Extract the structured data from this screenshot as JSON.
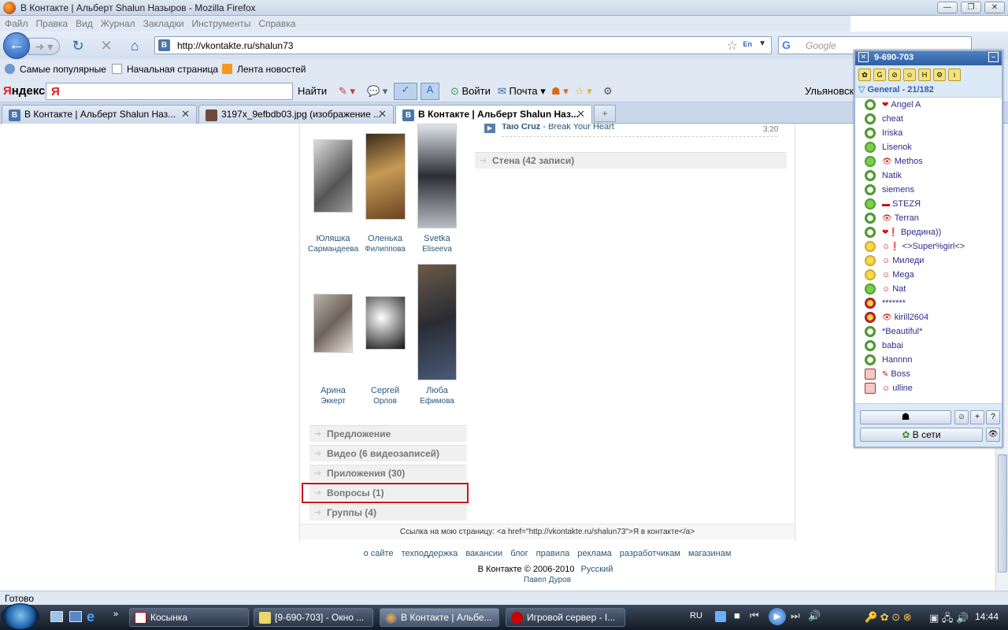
{
  "window": {
    "title": "В Контакте | Альберт Shalun Назыров - Mozilla Firefox",
    "buttons": [
      "—",
      "❐",
      "✕"
    ]
  },
  "menu": [
    "Файл",
    "Правка",
    "Вид",
    "Журнал",
    "Закладки",
    "Инструменты",
    "Справка"
  ],
  "navbar": {
    "url": "http://vkontakte.ru/shalun73",
    "lang_badge": "En",
    "search_placeholder": "Google"
  },
  "bookmarks": [
    "Самые популярные",
    "Начальная страница",
    "Лента новостей"
  ],
  "yandex": {
    "logo_prefix": "Я",
    "logo_rest": "ндекс",
    "input_logo": "Я",
    "find": "Найти",
    "login": "Войти",
    "mail": "Почта",
    "city": "Ульяновск"
  },
  "tabs": [
    {
      "label": "В Контакте | Альберт Shalun Наз..."
    },
    {
      "label": "3197x_9efbdb03.jpg (изображение ..."
    },
    {
      "label": "В Контакте | Альберт Shalun Наз..."
    }
  ],
  "page": {
    "friends": [
      {
        "first": "Юляшка",
        "last": "Сармандеева"
      },
      {
        "first": "Оленька",
        "last": "Филиппова"
      },
      {
        "first": "Svetka",
        "last": "Eliseeva"
      },
      {
        "first": "Арина",
        "last": "Эккерт"
      },
      {
        "first": "Сергей",
        "last": "Орлов"
      },
      {
        "first": "Люба",
        "last": "Ефимова"
      }
    ],
    "sections": [
      "Предложение",
      "Видео (6 видеозаписей)",
      "Приложения (30)",
      "Вопросы (1)",
      "Группы (4)"
    ],
    "music": {
      "artist": "Taio Cruz",
      "title": " - Break Your Heart",
      "duration": "3:20"
    },
    "wall": "Стена (42 записи)",
    "link_line": "Ссылка на мою страницу: <a href=\"http://vkontakte.ru/shalun73\">Я в контакте</a>",
    "footer_links": [
      "о сайте",
      "техподдержка",
      "вакансии",
      "блог",
      "правила",
      "реклама",
      "разработчикам",
      "магазинам"
    ],
    "copyright": "В Контакте © 2006-2010",
    "language": "Русский",
    "author": "Павел Дуров"
  },
  "icq": {
    "title": "9-690-703",
    "group": "General - ",
    "group_count": "21/182",
    "contacts": [
      {
        "name": "Angel A",
        "status": "off",
        "extra": "❤"
      },
      {
        "name": "cheat",
        "status": "off",
        "extra": ""
      },
      {
        "name": "Iriska",
        "status": "off",
        "extra": ""
      },
      {
        "name": "Lisenok",
        "status": "on",
        "extra": ""
      },
      {
        "name": "Methos",
        "status": "on",
        "extra": "👁"
      },
      {
        "name": "Natik",
        "status": "off",
        "extra": ""
      },
      {
        "name": "siemens",
        "status": "off",
        "extra": ""
      },
      {
        "name": "STEZЯ",
        "status": "on",
        "extra": "▬"
      },
      {
        "name": "Terran",
        "status": "off",
        "extra": "👁"
      },
      {
        "name": "Вредина))",
        "status": "off",
        "extra": "❤❗"
      },
      {
        "name": "<>Super%girl<>",
        "status": "away",
        "extra": "☺❗"
      },
      {
        "name": "Миледи",
        "status": "away",
        "extra": "☺"
      },
      {
        "name": "Mega",
        "status": "away",
        "extra": "☺"
      },
      {
        "name": "Nat",
        "status": "on",
        "extra": "☺"
      },
      {
        "name": "*******",
        "status": "dnd",
        "extra": ""
      },
      {
        "name": "kirill2604",
        "status": "dnd",
        "extra": "👁"
      },
      {
        "name": "*Beautiful*",
        "status": "off",
        "extra": ""
      },
      {
        "name": "babai",
        "status": "off",
        "extra": ""
      },
      {
        "name": "Hannnn",
        "status": "off",
        "extra": ""
      },
      {
        "name": "Boss",
        "status": "na",
        "extra": "✎"
      },
      {
        "name": "ulline",
        "status": "na",
        "extra": "☺"
      }
    ],
    "status_button": "В сети"
  },
  "statusbar": "Готово",
  "taskbar": {
    "tasks": [
      "Косынка",
      "[9-690-703] - Окно ...",
      "В Контакте | Альбе...",
      "Игровой сервер - I..."
    ],
    "lang": "RU",
    "clock": "14:44"
  },
  "colors": {
    "vk_blue": "#4a76a8",
    "highlight": "#c8141e",
    "link": "#2b587a"
  }
}
